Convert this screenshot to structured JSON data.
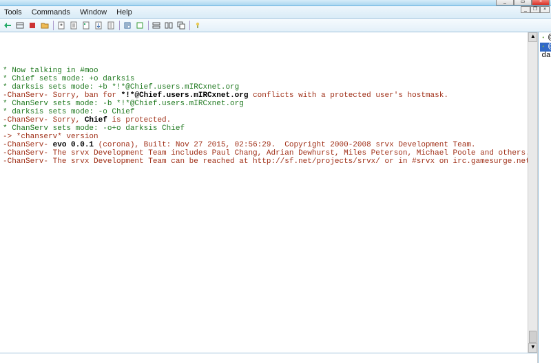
{
  "menu": {
    "tools": "Tools",
    "commands": "Commands",
    "window": "Window",
    "help": "Help"
  },
  "win": {
    "min": "_",
    "max": "▭",
    "close": "×",
    "restore": "❐"
  },
  "nicks": [
    {
      "label": "@ChanServ",
      "bullet": true
    },
    {
      "label": "@Chief",
      "bullet": true,
      "selected": true
    },
    {
      "label": "darksis",
      "bullet": false
    }
  ],
  "log": [
    {
      "cls": "dg",
      "txt": "* Now talking in #moo"
    },
    {
      "cls": "dg",
      "txt": "* Chief sets mode: +o darksis"
    },
    {
      "cls": "dg",
      "txt": "* darksis sets mode: +b *!*@Chief.users.mIRCxnet.org"
    },
    {
      "cls": "red",
      "pre": "-ChanServ- Sorry, ban for ",
      "b": "*!*@Chief.users.mIRCxnet.org",
      "post": " conflicts with a protected user's hostmask."
    },
    {
      "cls": "dg",
      "txt": "* ChanServ sets mode: -b *!*@Chief.users.mIRCxnet.org"
    },
    {
      "cls": "dg",
      "txt": "* darksis sets mode: -o Chief"
    },
    {
      "cls": "red",
      "pre": "-ChanServ- Sorry, ",
      "b": "Chief",
      "post": " is protected."
    },
    {
      "cls": "dg",
      "txt": "* ChanServ sets mode: -o+o darksis Chief"
    },
    {
      "cls": "red",
      "txt": "-> *chanserv* version"
    },
    {
      "cls": "red",
      "pre": "-ChanServ- ",
      "b": "evo 0.0.1",
      "post": " (corona), Built: Nov 27 2015, 02:56:29.  Copyright 2000-2008 srvx Development Team."
    },
    {
      "cls": "red",
      "txt": "-ChanServ- The srvx Development Team includes Paul Chang, Adrian Dewhurst, Miles Peterson, Michael Poole and others."
    },
    {
      "cls": "red",
      "txt": "-ChanServ- The srvx Development Team can be reached at http://sf.net/projects/srvx/ or in #srvx on irc.gamesurge.net."
    }
  ]
}
